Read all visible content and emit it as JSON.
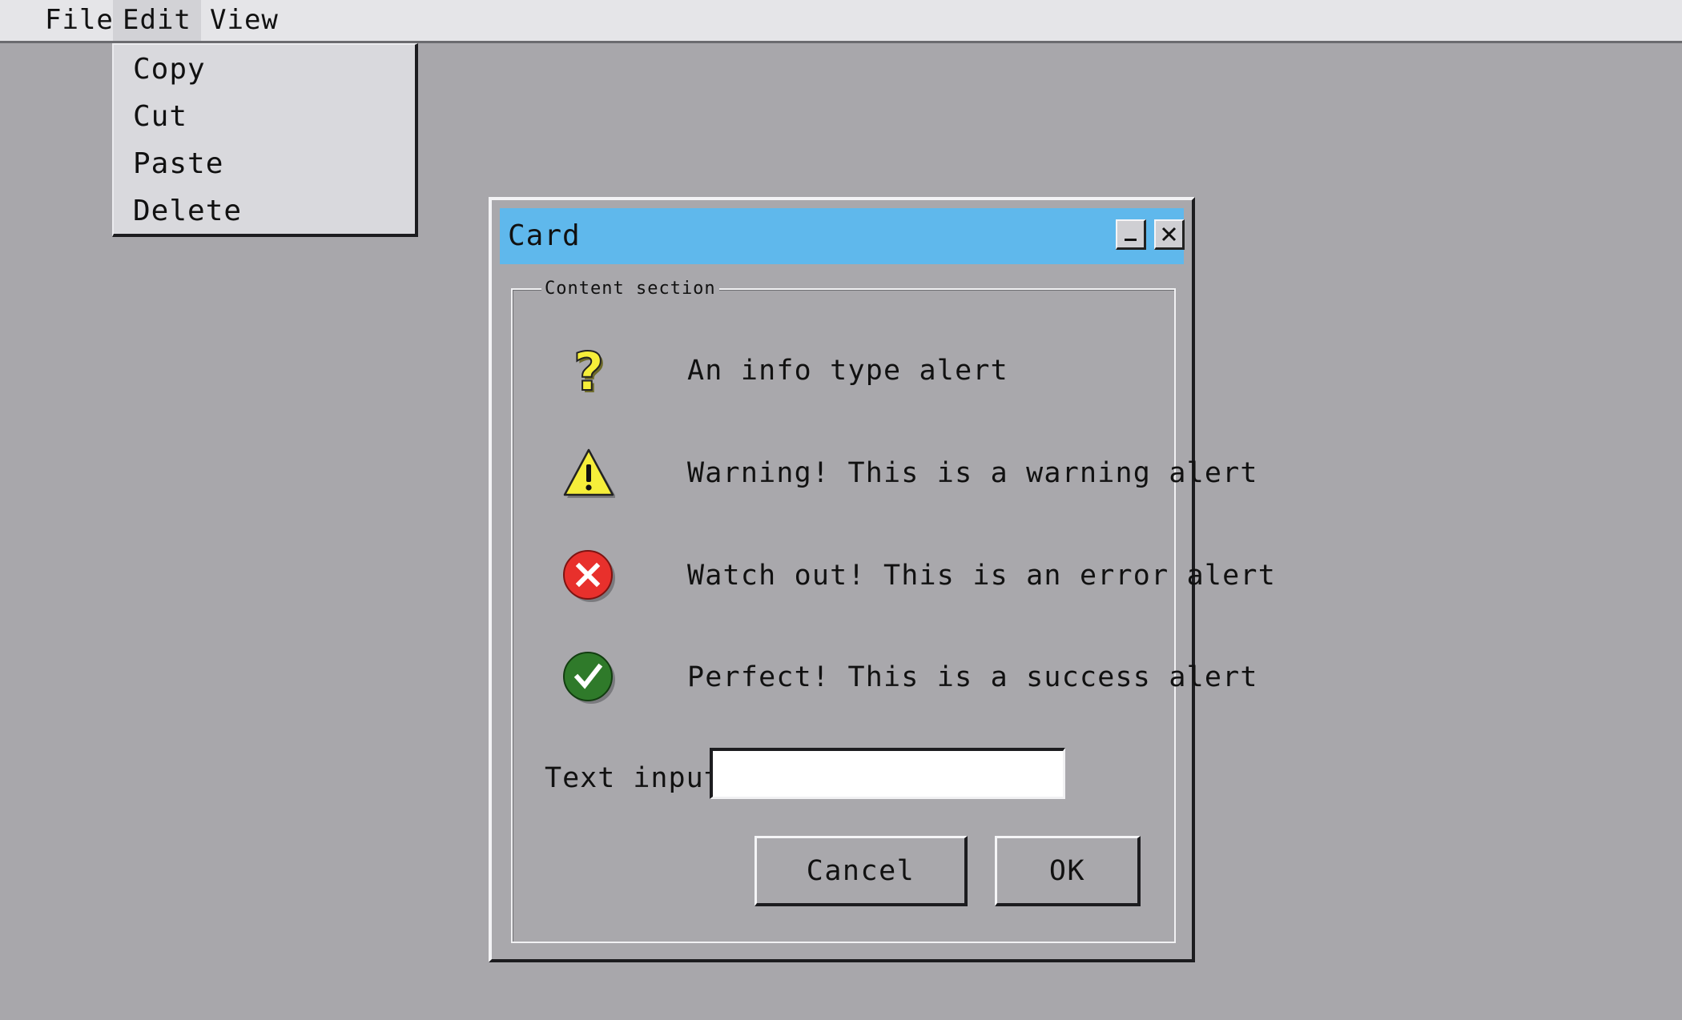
{
  "menubar": {
    "items": [
      {
        "label": "File"
      },
      {
        "label": "Edit"
      },
      {
        "label": "View"
      }
    ]
  },
  "dropdown": {
    "items": [
      {
        "label": "Copy"
      },
      {
        "label": "Cut"
      },
      {
        "label": "Paste"
      },
      {
        "label": "Delete"
      }
    ]
  },
  "window": {
    "title": "Card",
    "controls": {
      "minimize_icon": "minimize-icon",
      "close_icon": "close-icon"
    },
    "fieldset_legend": "Content section",
    "alerts": [
      {
        "type": "info",
        "icon": "question-icon",
        "text": "An info type alert"
      },
      {
        "type": "warning",
        "icon": "warning-icon",
        "text": "Warning! This is a warning alert"
      },
      {
        "type": "error",
        "icon": "error-icon",
        "text": "Watch out! This is an error alert"
      },
      {
        "type": "success",
        "icon": "success-icon",
        "text": "Perfect! This is a success alert"
      }
    ],
    "input": {
      "label": "Text input",
      "value": "",
      "placeholder": ""
    },
    "buttons": {
      "cancel": "Cancel",
      "ok": "OK"
    }
  },
  "colors": {
    "desktop": "#a8a7ab",
    "titlebar": "#5fb8ec",
    "info": "#f6ee3a",
    "warning": "#f6ee3a",
    "error": "#e8302c",
    "success": "#2f7a2a"
  }
}
